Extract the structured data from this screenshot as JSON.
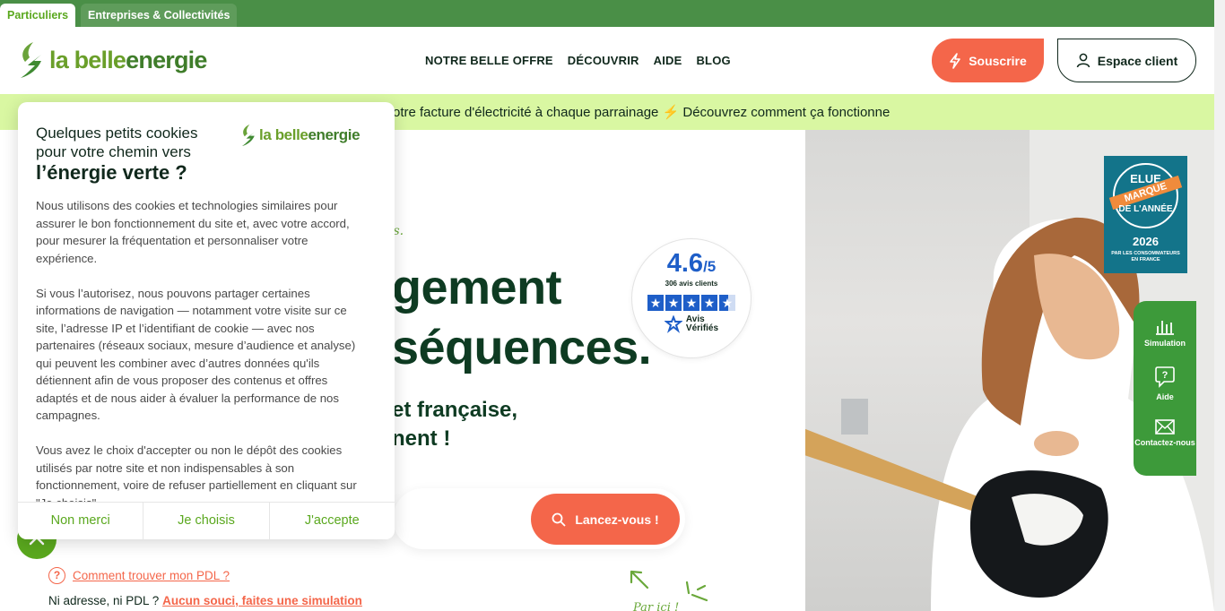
{
  "segments": {
    "particuliers": "Particuliers",
    "entreprises": "Entreprises & Collectivités"
  },
  "logo": {
    "part1": "la belle",
    "part2": "energie"
  },
  "nav": [
    "NOTRE BELLE OFFRE",
    "DÉCOUVRIR",
    "AIDE",
    "BLOG"
  ],
  "header": {
    "subscribe": "Souscrire",
    "client_space": "Espace client"
  },
  "promo": {
    "text": "otre facture d'électricité à chaque parrainage ⚡ Découvrez comment ça fonctionne"
  },
  "hero": {
    "tagline": "nis.",
    "title_line1": "gement",
    "title_line2": "séquences.",
    "subtitle_line1": "et française,",
    "subtitle_line2": "nent !",
    "launch_button": "Lancez-vous !",
    "pdl_link": "Comment trouver mon PDL ?",
    "no_address_text": "Ni adresse, ni PDL ?",
    "simulation_link": "Aucun souci, faites une simulation",
    "arrow_note": "Par ici !"
  },
  "rating": {
    "score": "4.6",
    "out_of": "/5",
    "count": "306 avis clients",
    "stars": 4.6,
    "brand_line1": "Avis",
    "brand_line2": "Vérifiés"
  },
  "award": {
    "line1": "ELUE",
    "line2": "MARQUE",
    "line3": "DE L'ANNÉE",
    "year": "2026",
    "note": "PAR LES CONSOMMATEURS EN FRANCE"
  },
  "side_panel": {
    "simulation": "Simulation",
    "aide": "Aide",
    "contact": "Contactez-nous"
  },
  "cookie": {
    "title_line1": "Quelques petits cookies",
    "title_line2": "pour votre chemin vers",
    "title_bold": "l’énergie verte ?",
    "paragraph1": "Nous utilisons des cookies et technologies similaires pour assurer le bon fonctionnement du site et, avec votre accord, pour mesurer la fréquentation et personnaliser votre expérience.",
    "paragraph2": "Si vous l’autorisez, nous pouvons partager certaines informations de navigation — notamment votre visite sur ce site, l’adresse IP et l’identifiant de cookie — avec nos partenaires (réseaux sociaux, mesure d’audience et analyse) qui peuvent les combiner avec d’autres données qu'ils détiennent afin de vous proposer des contenus et offres adaptés et de nous aider à évaluer la performance de nos campagnes.",
    "paragraph3": "Vous avez le choix d'accepter ou non le dépôt des cookies utilisés par notre site et non indispensables à son fonctionnement, voire de refuser partiellement en cliquant sur \"Je choisis\".",
    "btn_refuse": "Non merci",
    "btn_choose": "Je choisis",
    "btn_accept": "J'accepte"
  },
  "colors": {
    "brand_green": "#4a8f47",
    "accent_orange": "#f4664a",
    "promo_bg": "#d9f7a2",
    "dark_text": "#0e3b22",
    "star_blue": "#1e5ec8"
  }
}
